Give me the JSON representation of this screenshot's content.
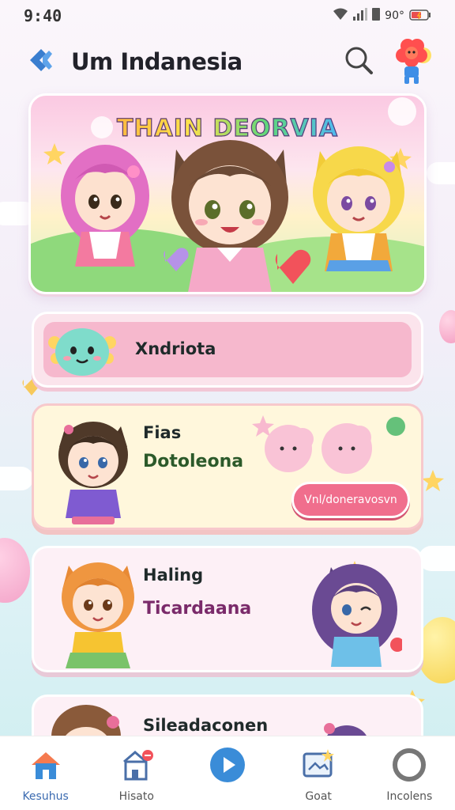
{
  "status_bar": {
    "time": "9:40",
    "network_text": "90°"
  },
  "header": {
    "title": "Um Indanesia",
    "back_icon": "back-arrow-icon",
    "search_icon": "search-icon",
    "mascot": "flower-mascot"
  },
  "hero": {
    "title": "THAIN DEORVIA"
  },
  "cards": [
    {
      "label": "Xndriota"
    },
    {
      "label": "Fias",
      "subtitle": "Dotoleona",
      "button": "Vnl/doneravosvn"
    },
    {
      "label": "Haling",
      "subtitle": "Ticardaana"
    },
    {
      "label": "Sileadaconen"
    }
  ],
  "nav": [
    {
      "label": "Kesuhus",
      "icon": "home-icon",
      "active": true
    },
    {
      "label": "Hisato",
      "icon": "store-icon",
      "active": false
    },
    {
      "label": "",
      "icon": "play-icon",
      "active": false
    },
    {
      "label": "Goat",
      "icon": "sparkle-card-icon",
      "active": false
    },
    {
      "label": "Incolens",
      "icon": "ring-icon",
      "active": false
    }
  ],
  "colors": {
    "accent_pink": "#f06e8d",
    "card_pink": "#f6b8cd",
    "card_yellow": "#fff7dc",
    "nav_blue": "#3a8cd8"
  }
}
